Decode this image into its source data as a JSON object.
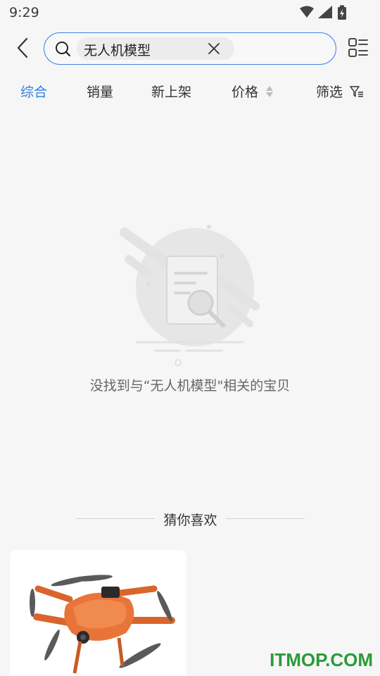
{
  "status": {
    "time": "9:29"
  },
  "search": {
    "query": "无人机模型"
  },
  "filters": [
    "综合",
    "销量",
    "新上架",
    "价格",
    "筛选"
  ],
  "active_filter": "综合",
  "empty": {
    "message": "没找到与“无人机模型\"相关的宝贝"
  },
  "recommend": {
    "title": "猜你喜欢"
  },
  "watermark": "ITMOP.COM",
  "colors": {
    "accent": "#2f7fe6",
    "background": "#f6f6f6",
    "product_orange": "#e8743a"
  }
}
